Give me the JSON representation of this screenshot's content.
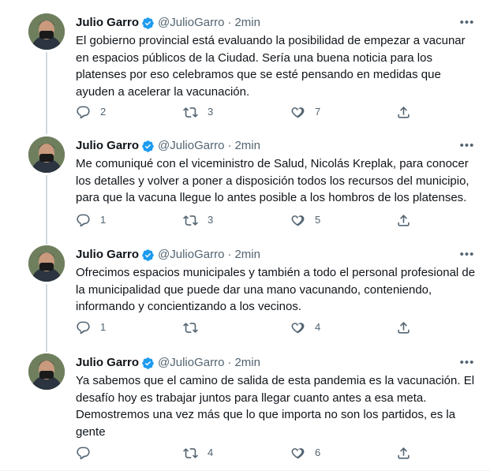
{
  "accent_color": "#1d9bf0",
  "thread_line_color": "#cfd9de",
  "tweets": [
    {
      "author": "Julio Garro",
      "handle": "@JulioGarro",
      "separator": "·",
      "time": "2min",
      "more": "•••",
      "verified": true,
      "text": "El gobierno provincial está evaluando la posibilidad de empezar a vacunar en espacios públicos de la Ciudad. Sería una buena noticia para los platenses por eso celebramos que se esté pensando en medidas que ayuden a acelerar la vacunación.",
      "replies": "2",
      "retweets": "3",
      "likes": "7"
    },
    {
      "author": "Julio Garro",
      "handle": "@JulioGarro",
      "separator": "·",
      "time": "2min",
      "more": "•••",
      "verified": true,
      "text": "Me comuniqué con el viceministro de Salud, Nicolás Kreplak, para conocer los detalles y volver a poner a disposición todos los recursos del municipio, para que la vacuna llegue lo antes posible a los hombros de los platenses.",
      "replies": "1",
      "retweets": "3",
      "likes": "5"
    },
    {
      "author": "Julio Garro",
      "handle": "@JulioGarro",
      "separator": "·",
      "time": "2min",
      "more": "•••",
      "verified": true,
      "text": "Ofrecimos espacios municipales y también a todo el personal profesional de la municipalidad que puede dar una mano vacunando, conteniendo, informando y concientizando a los vecinos.",
      "replies": "1",
      "retweets": "",
      "likes": "4"
    },
    {
      "author": "Julio Garro",
      "handle": "@JulioGarro",
      "separator": "·",
      "time": "2min",
      "more": "•••",
      "verified": true,
      "text": "Ya sabemos que el camino de salida de esta pandemia es la vacunación. El desafío hoy es trabajar juntos para llegar cuanto antes a esa meta. Demostremos una vez más que lo que importa no son los partidos, es la gente",
      "replies": "",
      "retweets": "4",
      "likes": "6"
    }
  ]
}
